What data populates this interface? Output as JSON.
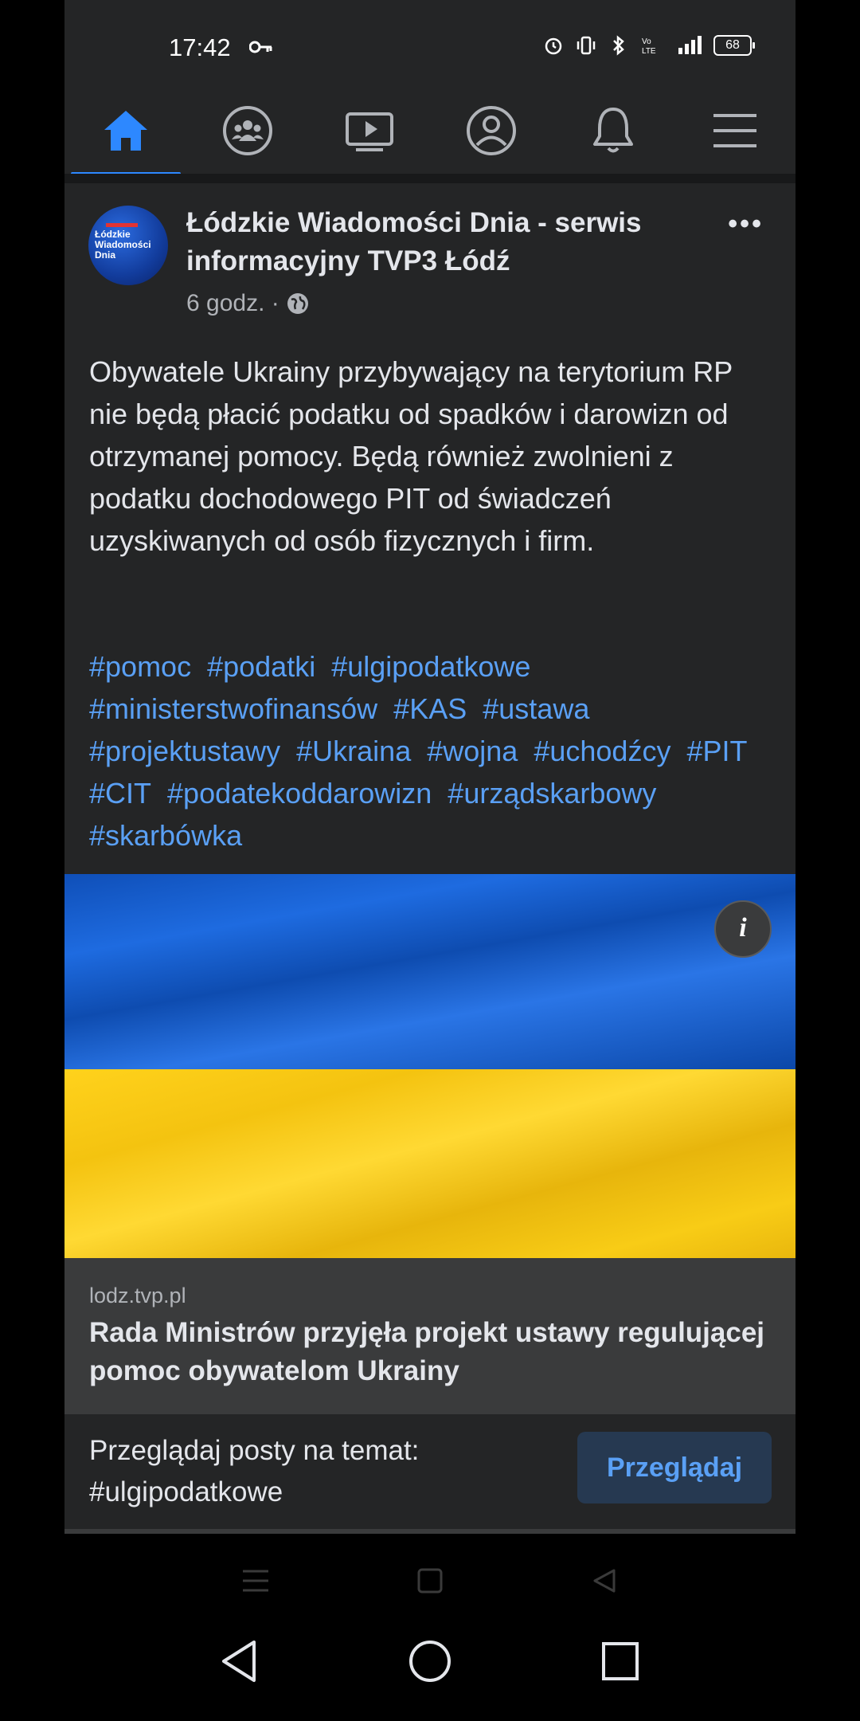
{
  "status_bar": {
    "time": "17:42",
    "battery": "68",
    "icons": [
      "key-icon",
      "alarm-icon",
      "vibrate-icon",
      "bluetooth-icon",
      "volte-icon",
      "signal-icon",
      "battery-icon"
    ]
  },
  "nav": {
    "items": [
      "home-icon",
      "groups-icon",
      "watch-icon",
      "profile-icon",
      "notifications-icon",
      "menu-icon"
    ],
    "active": "home-icon",
    "accent": "#2d88ff"
  },
  "post": {
    "author": "Łódzkie Wiadomości Dnia - serwis informacyjny TVP3 Łódź",
    "avatar_text": "Łódzkie Wiadomości Dnia",
    "time": "6 godz. ·",
    "body": "Obywatele Ukrainy przybywający na terytorium RP nie będą płacić podatku od spadków i darowizn od otrzymanej pomocy. Będą również zwolnieni z podatku dochodowego PIT od świadczeń uzyskiwanych od osób fizycznych i firm.",
    "hashtags": [
      "#pomoc",
      "#podatki",
      "#ulgipodatkowe",
      "#ministerstwofinansów",
      "#KAS",
      "#ustawa",
      "#projektustawy",
      "#Ukraina",
      "#wojna",
      "#uchodźcy",
      "#PIT",
      "#CIT",
      "#podatekoddarowizn",
      "#urządskarbowy",
      "#skarbówka"
    ],
    "more": "•••",
    "info": "i"
  },
  "link": {
    "domain": "lodz.tvp.pl",
    "title": "Rada Ministrów przyjęła projekt ustawy regulującej pomoc obywatelom Ukrainy"
  },
  "browse": {
    "text": "Przeglądaj posty na temat: #ulgipodatkowe",
    "button": "Przeglądaj"
  }
}
